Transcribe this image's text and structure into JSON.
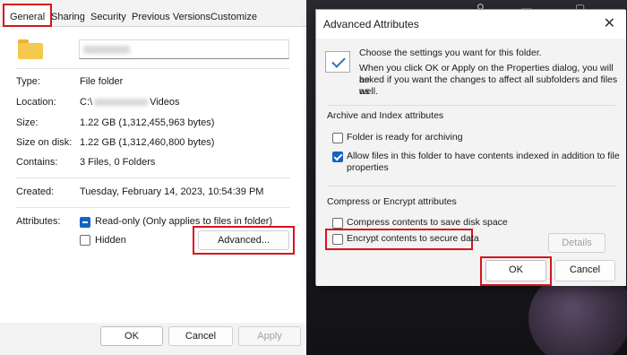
{
  "properties": {
    "tabs": [
      "General",
      "Sharing",
      "Security",
      "Previous Versions",
      "Customize"
    ],
    "rows": {
      "type_label": "Type:",
      "type_value": "File folder",
      "location_label": "Location:",
      "location_value_prefix": "C:\\",
      "location_value_suffix": "Videos",
      "size_label": "Size:",
      "size_value": "1.22 GB (1,312,455,963 bytes)",
      "size_on_disk_label": "Size on disk:",
      "size_on_disk_value": "1.22 GB (1,312,460,800 bytes)",
      "contains_label": "Contains:",
      "contains_value": "3 Files, 0 Folders",
      "created_label": "Created:",
      "created_value": "Tuesday, February 14, 2023, 10:54:39 PM",
      "attributes_label": "Attributes:"
    },
    "attributes": {
      "readonly_label": "Read-only (Only applies to files in folder)",
      "hidden_label": "Hidden",
      "advanced_button": "Advanced..."
    },
    "footer": {
      "ok": "OK",
      "cancel": "Cancel",
      "apply": "Apply"
    }
  },
  "advanced": {
    "title": "Advanced Attributes",
    "intro_line1": "Choose the settings you want for this folder.",
    "intro_line2": "When you click OK or Apply on the Properties dialog, you will be",
    "intro_line3": "asked if you want the changes to affect all subfolders and files as",
    "intro_line4": "well.",
    "archive_group": "Archive and Index attributes",
    "archive_ready": "Folder is ready for archiving",
    "index_line1": "Allow files in this folder to have contents indexed in addition to file",
    "index_line2": "properties",
    "compress_group": "Compress or Encrypt attributes",
    "compress": "Compress contents to save disk space",
    "encrypt": "Encrypt contents to secure data",
    "details": "Details",
    "ok": "OK",
    "cancel": "Cancel",
    "close_glyph": "✕"
  },
  "colors": {
    "highlight_red": "#d8141b",
    "accent_blue": "#1364c4"
  }
}
